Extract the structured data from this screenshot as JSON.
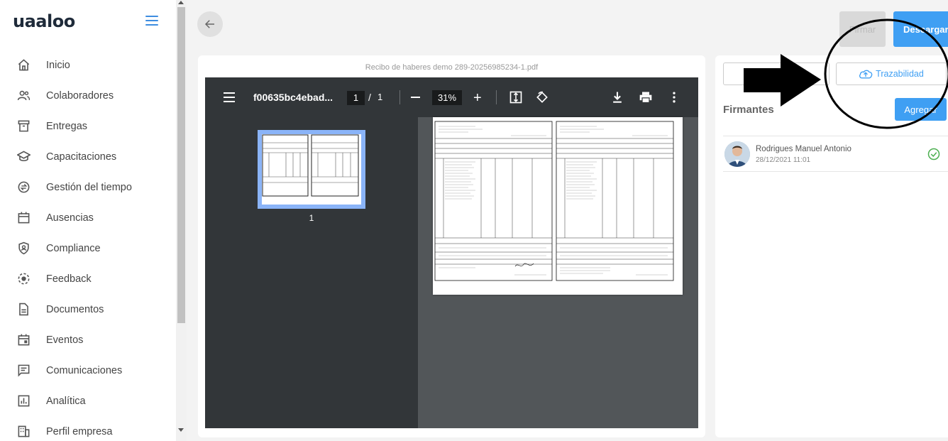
{
  "app": {
    "logo_text": "uaaloo"
  },
  "sidebar": {
    "items": [
      {
        "label": "Inicio",
        "icon": "home-icon"
      },
      {
        "label": "Colaboradores",
        "icon": "people-icon"
      },
      {
        "label": "Entregas",
        "icon": "archive-icon"
      },
      {
        "label": "Capacitaciones",
        "icon": "graduation-cap-icon"
      },
      {
        "label": "Gestión del tiempo",
        "icon": "time-exchange-icon"
      },
      {
        "label": "Ausencias",
        "icon": "calendar-icon"
      },
      {
        "label": "Compliance",
        "icon": "shield-person-icon"
      },
      {
        "label": "Feedback",
        "icon": "feedback-icon"
      },
      {
        "label": "Documentos",
        "icon": "document-icon"
      },
      {
        "label": "Eventos",
        "icon": "event-icon"
      },
      {
        "label": "Comunicaciones",
        "icon": "message-icon"
      },
      {
        "label": "Analítica",
        "icon": "chart-icon"
      },
      {
        "label": "Perfil empresa",
        "icon": "building-icon"
      }
    ]
  },
  "header": {
    "firmar_label": "Firmar",
    "descargar_label": "Descargar"
  },
  "viewer": {
    "file_title": "Recibo de haberes demo 289-20256985234-1.pdf",
    "toolbar": {
      "filename": "f00635bc4ebad...",
      "page_current": "1",
      "page_separator": "/",
      "page_total": "1",
      "zoom": "31%"
    },
    "thumbnail_label": "1"
  },
  "right_panel": {
    "traceability_label": "Trazabilidad",
    "signers_title": "Firmantes",
    "add_label": "Agregar",
    "signers": [
      {
        "name": "Rodrigues Manuel Antonio",
        "date": "28/12/2021 11:01"
      }
    ]
  },
  "colors": {
    "accent": "#3f9ff3",
    "success": "#4caf50"
  }
}
